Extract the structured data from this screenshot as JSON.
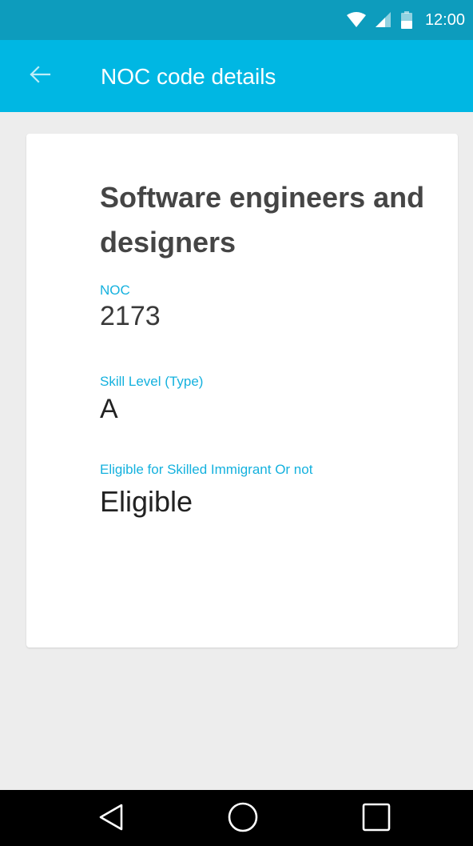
{
  "status_bar": {
    "time": "12:00",
    "icons": [
      "wifi-icon",
      "cellular-signal-icon",
      "battery-icon"
    ]
  },
  "app_bar": {
    "title": "NOC code details",
    "back_icon": "arrow-left-icon"
  },
  "details": {
    "occupation": "Software engineers and designers",
    "noc_label": "NOC",
    "noc_value": "2173",
    "skill_label": "Skill Level (Type)",
    "skill_value": "A",
    "eligible_label": "Eligible for Skilled Immigrant Or not",
    "eligible_value": "Eligible"
  },
  "nav_bar": {
    "icons": [
      "triangle-back-icon",
      "circle-home-icon",
      "square-recents-icon"
    ]
  },
  "colors": {
    "status_bar": "#0d9cbd",
    "app_bar": "#00b7e3",
    "accent_label": "#14b1de",
    "background": "#ededed",
    "card": "#ffffff",
    "nav_bar": "#000000"
  }
}
